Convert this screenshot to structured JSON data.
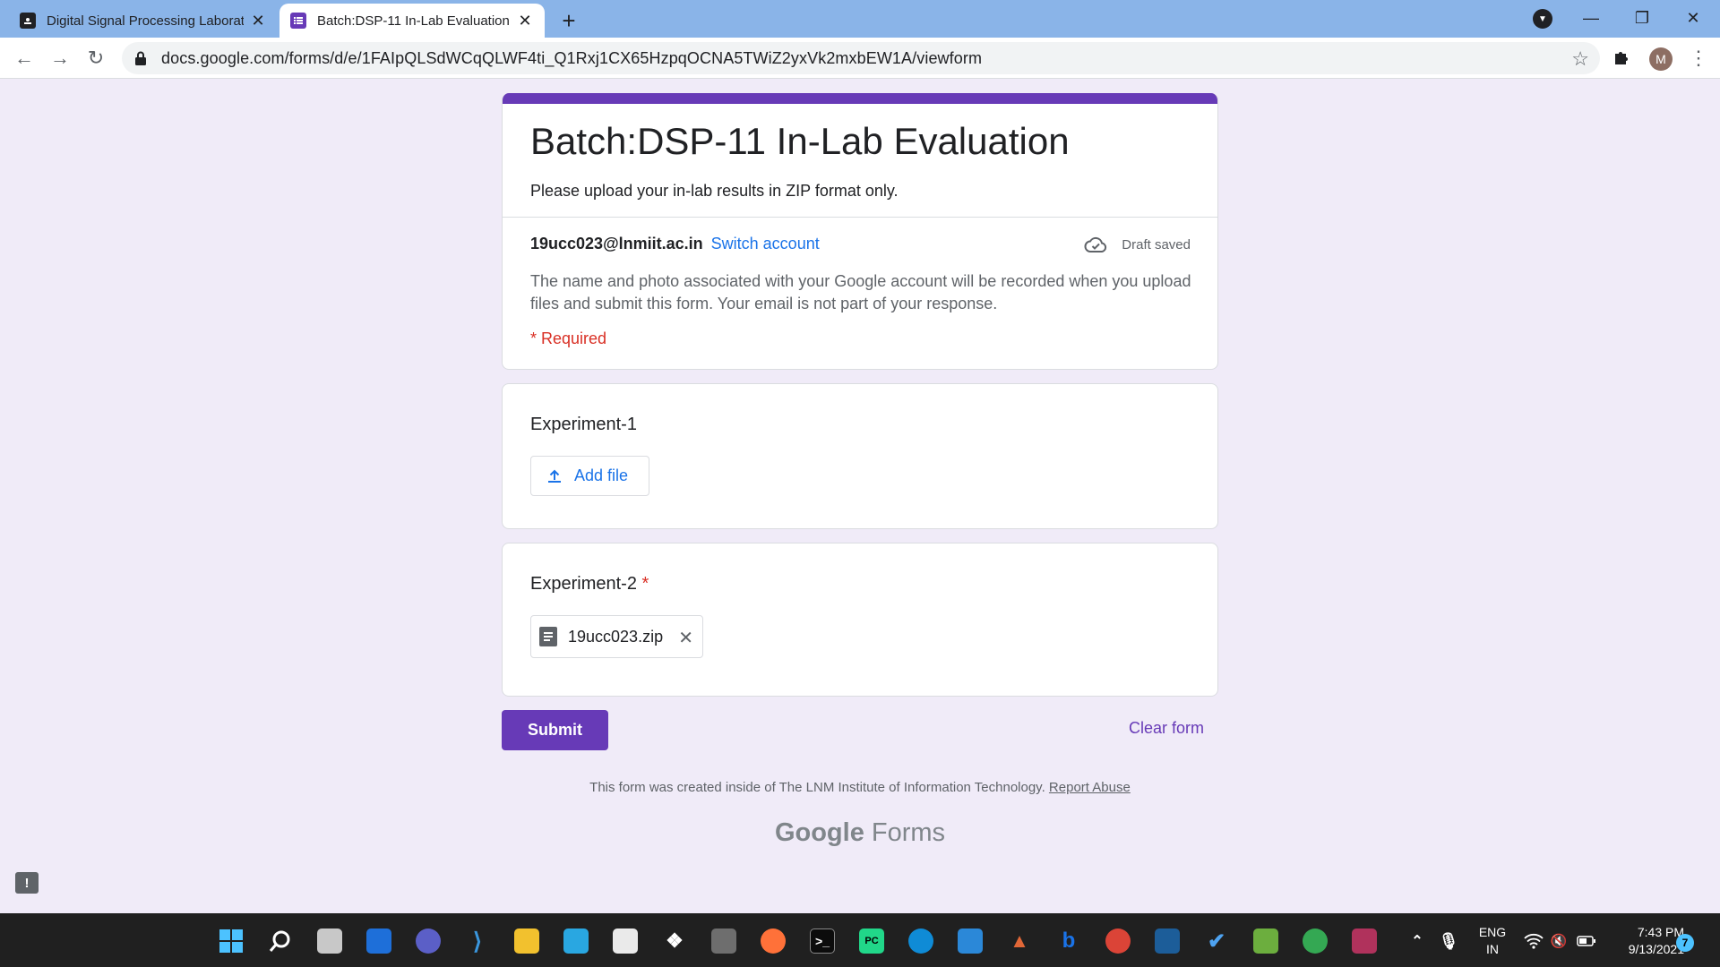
{
  "browser": {
    "tabs": [
      {
        "title": "Digital Signal Processing Laborat",
        "active": false
      },
      {
        "title": "Batch:DSP-11 In-Lab Evaluation",
        "active": true
      }
    ],
    "url": "docs.google.com/forms/d/e/1FAIpQLSdWCqQLWF4ti_Q1Rxj1CX65HzpqOCNA5TWiZ2yxVk2mxbEW1A/viewform",
    "profile_initial": "M"
  },
  "form": {
    "title": "Batch:DSP-11 In-Lab Evaluation",
    "description": "Please upload your in-lab results in ZIP format only.",
    "account_email": "19ucc023@lnmiit.ac.in",
    "switch_account": "Switch account",
    "draft_status": "Draft saved",
    "notice": "The name and photo associated with your Google account will be recorded when you upload files and submit this form. Your email is not part of your response.",
    "required_note": "* Required",
    "questions": [
      {
        "title": "Experiment-1",
        "required": false,
        "action_label": "Add file"
      },
      {
        "title": "Experiment-2",
        "required": true,
        "required_mark": "*",
        "file_name": "19ucc023.zip"
      }
    ],
    "submit_label": "Submit",
    "clear_label": "Clear form",
    "footer_text": "This form was created inside of The LNM Institute of Information Technology.",
    "report_abuse": "Report Abuse",
    "brand_google": "Google",
    "brand_forms": "Forms"
  },
  "taskbar": {
    "lang_line1": "ENG",
    "lang_line2": "IN",
    "time": "7:43 PM",
    "date": "9/13/2021",
    "notification_count": "7"
  },
  "colors": {
    "accent": "#673ab7",
    "link": "#1a73e8",
    "required": "#d93025",
    "background": "#f0ebf8"
  }
}
